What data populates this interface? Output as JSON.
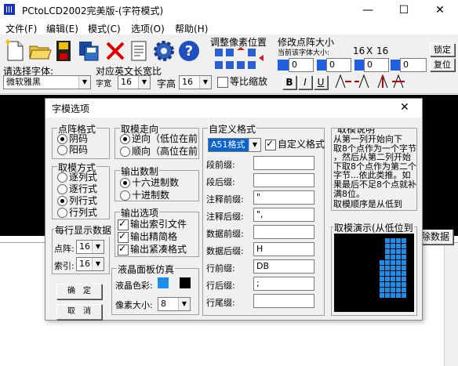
{
  "window": {
    "title": "PCtoLCD2002完美版-(字符模式)",
    "minimize": "—",
    "maximize": "☐",
    "close": "✕"
  },
  "menu": [
    "文件(F)",
    "编辑(E)",
    "模式(C)",
    "选项(O)",
    "帮助(H)"
  ],
  "toolbar": {
    "adjust_pixel_label": "调整像素位置",
    "modify_size_label": "修改点阵大小",
    "current_size_caption": "当前该字体大小:",
    "width": "16",
    "x": "X",
    "height": "16",
    "lock_button": "锁定",
    "reset_button": "复位",
    "spin_values": [
      "0",
      "0",
      "0",
      "0",
      "0"
    ],
    "font_prompt": "请选择字体:",
    "font_value": "微软雅黑",
    "mid_label": "对应英文长宽比",
    "width_label": "字宽",
    "width_value": "16",
    "height_label": "字高",
    "height_value": "16",
    "scale_label": "等比缩放",
    "bold": "B",
    "italic": "I",
    "underline": "U",
    "clear_data": "除数据"
  },
  "dialog": {
    "title": "字模选项",
    "close": "✕",
    "matrix_format": {
      "label": "点阵格式",
      "options": [
        "阴码",
        "阳码"
      ],
      "selected": "阴码"
    },
    "take_mode": {
      "label": "取模方式",
      "options": [
        "逐列式",
        "逐行式",
        "列行式",
        "行列式"
      ],
      "selected": "列行式"
    },
    "per_line": {
      "label": "每行显示数据",
      "dot_label": "点阵:",
      "dot_value": "16",
      "index_label": "索引:",
      "index_value": "16"
    },
    "ok_button": "确　定",
    "cancel_button": "取　消",
    "direction": {
      "label": "取模走向",
      "options": [
        "逆向（低位在前",
        "顺向（高位在前"
      ],
      "selected": "逆向（低位在前"
    },
    "number_system": {
      "label": "输出数制",
      "options": [
        "十六进制数",
        "十进制数"
      ],
      "selected": "十六进制数"
    },
    "output_options": {
      "label": "输出选项",
      "items": [
        "输出索引文件",
        "输出精简格",
        "输出紧凑格式"
      ]
    },
    "lcd_sim": {
      "label": "液晶面板仿真",
      "color_label": "液晶色彩:",
      "pixel_label": "像素大小:",
      "pixel_value": "8",
      "fg_color": "#1e8fe8",
      "bg_color": "#000000"
    },
    "custom_format": {
      "label": "自定义格式",
      "format_value": "A51格式",
      "custom_check": "自定义格式",
      "fields": [
        {
          "label": "段前缀:",
          "value": ""
        },
        {
          "label": "段后缀:",
          "value": ""
        },
        {
          "label": "注释前缀:",
          "value": "\""
        },
        {
          "label": "注释后缀:",
          "value": "\","
        },
        {
          "label": "数据前缀:",
          "value": ""
        },
        {
          "label": "数据后缀:",
          "value": "H"
        },
        {
          "label": "行前缀:",
          "value": "DB"
        },
        {
          "label": "行后缀:",
          "value": ";"
        },
        {
          "label": "行尾缀:",
          "value": ""
        }
      ]
    },
    "explanation": {
      "label": "取模说明",
      "lines": [
        "从第一列开始向下",
        "取8个点作为一个字节",
        "，然后从第二列开始",
        "下取8个点作为第二个",
        "字节...依此类推。如",
        "果最后不足8个点就补",
        "满8位。",
        "取模顺序是从低到"
      ]
    },
    "demo": {
      "label": "取模演示(从低位到"
    }
  }
}
